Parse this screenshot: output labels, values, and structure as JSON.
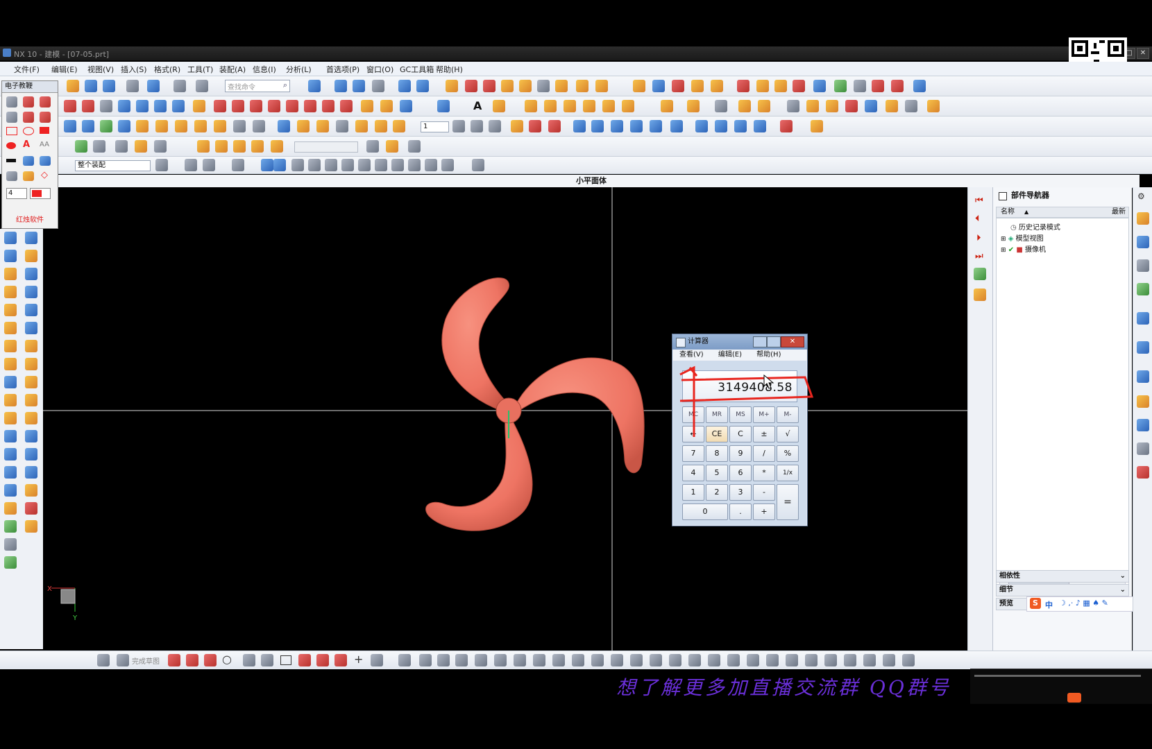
{
  "window": {
    "title": "NX 10 - 建模 - [07-05.prt]",
    "controls": [
      "_",
      "□",
      "✕"
    ]
  },
  "menu": [
    "文件(F)",
    "编辑(E)",
    "视图(V)",
    "插入(S)",
    "格式(R)",
    "工具(T)",
    "装配(A)",
    "信息(I)",
    "分析(L)",
    "首选项(P)",
    "窗口(O)",
    "GC工具箱",
    "帮助(H)"
  ],
  "toolbar": {
    "search_placeholder": "查找命令",
    "filter_label": "整个装配",
    "layer_value": "1"
  },
  "palette": {
    "title": "电子教鞭",
    "size_value": "4",
    "footer": "红烛软件"
  },
  "viewport": {
    "title": "小平面体",
    "background": "#000000",
    "propeller_color": "#ee7463"
  },
  "navigator": {
    "title": "部件导航器",
    "col_name": "名称",
    "col_latest": "最新",
    "items": [
      "历史记录模式",
      "模型视图",
      "摄像机"
    ],
    "sections": [
      "相依性",
      "细节",
      "预览"
    ]
  },
  "calculator": {
    "title": "计算器",
    "menu": [
      "查看(V)",
      "编辑(E)",
      "帮助(H)"
    ],
    "display": "3149408.58",
    "memory_keys": [
      "MC",
      "MR",
      "MS",
      "M+",
      "M-"
    ],
    "rows": [
      [
        "←",
        "CE",
        "C",
        "±",
        "√"
      ],
      [
        "7",
        "8",
        "9",
        "/",
        "%"
      ],
      [
        "4",
        "5",
        "6",
        "*",
        "1/x"
      ],
      [
        "1",
        "2",
        "3",
        "-"
      ]
    ],
    "zero": "0",
    "dot": ".",
    "plus": "+",
    "equals": "="
  },
  "bottom_toolbar": {
    "finish_sketch": "完成草图"
  },
  "overlay": {
    "promo": "想了解更多加直播交流群   QQ群号"
  },
  "ime": [
    "S",
    "中"
  ]
}
